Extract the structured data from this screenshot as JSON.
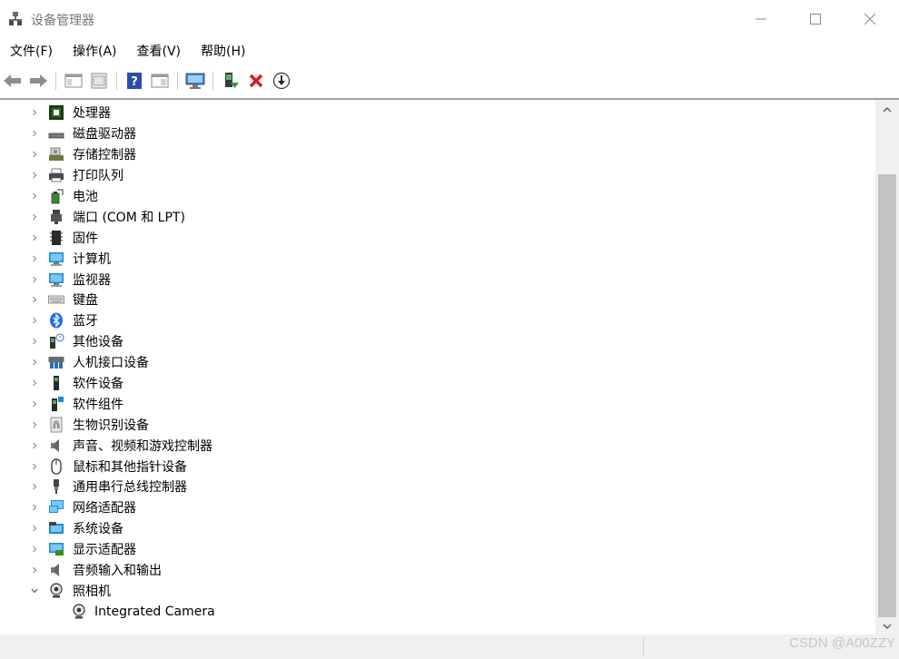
{
  "window": {
    "title": "设备管理器",
    "controls": [
      "minimize",
      "maximize",
      "close"
    ]
  },
  "menu": [
    {
      "label": "文件(F)"
    },
    {
      "label": "操作(A)"
    },
    {
      "label": "查看(V)"
    },
    {
      "label": "帮助(H)"
    }
  ],
  "toolbar": {
    "buttons": [
      "back-icon",
      "forward-icon",
      "show-hide-tree-icon",
      "properties-icon",
      "help-icon",
      "action-pane-icon",
      "scan-hardware-icon",
      "update-driver-icon",
      "uninstall-icon",
      "disable-device-icon"
    ]
  },
  "tree": {
    "items": [
      {
        "label": "处理器",
        "icon": "processor-icon"
      },
      {
        "label": "磁盘驱动器",
        "icon": "disk-drive-icon"
      },
      {
        "label": "存储控制器",
        "icon": "storage-controller-icon"
      },
      {
        "label": "打印队列",
        "icon": "printer-icon"
      },
      {
        "label": "电池",
        "icon": "battery-icon"
      },
      {
        "label": "端口 (COM 和 LPT)",
        "icon": "port-icon"
      },
      {
        "label": "固件",
        "icon": "firmware-icon"
      },
      {
        "label": "计算机",
        "icon": "computer-icon"
      },
      {
        "label": "监视器",
        "icon": "monitor-icon"
      },
      {
        "label": "键盘",
        "icon": "keyboard-icon"
      },
      {
        "label": "蓝牙",
        "icon": "bluetooth-icon"
      },
      {
        "label": "其他设备",
        "icon": "other-devices-icon"
      },
      {
        "label": "人机接口设备",
        "icon": "hid-icon"
      },
      {
        "label": "软件设备",
        "icon": "software-device-icon"
      },
      {
        "label": "软件组件",
        "icon": "software-component-icon"
      },
      {
        "label": "生物识别设备",
        "icon": "fingerprint-icon"
      },
      {
        "label": "声音、视频和游戏控制器",
        "icon": "speaker-icon"
      },
      {
        "label": "鼠标和其他指针设备",
        "icon": "mouse-icon"
      },
      {
        "label": "通用串行总线控制器",
        "icon": "usb-icon"
      },
      {
        "label": "网络适配器",
        "icon": "network-adapter-icon"
      },
      {
        "label": "系统设备",
        "icon": "system-devices-icon"
      },
      {
        "label": "显示适配器",
        "icon": "display-adapter-icon"
      },
      {
        "label": "音频输入和输出",
        "icon": "audio-io-icon"
      },
      {
        "label": "照相机",
        "icon": "camera-icon",
        "expanded": true
      },
      {
        "label": "Integrated Camera",
        "icon": "camera-icon",
        "child": true
      }
    ]
  },
  "watermark": "CSDN @A00ZZY"
}
